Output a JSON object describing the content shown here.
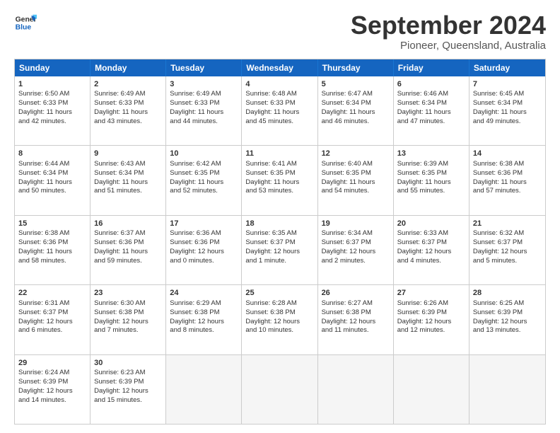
{
  "logo": {
    "line1": "General",
    "line2": "Blue"
  },
  "title": "September 2024",
  "subtitle": "Pioneer, Queensland, Australia",
  "header_days": [
    "Sunday",
    "Monday",
    "Tuesday",
    "Wednesday",
    "Thursday",
    "Friday",
    "Saturday"
  ],
  "weeks": [
    [
      {
        "day": "1",
        "lines": [
          "Sunrise: 6:50 AM",
          "Sunset: 6:33 PM",
          "Daylight: 11 hours",
          "and 42 minutes."
        ]
      },
      {
        "day": "2",
        "lines": [
          "Sunrise: 6:49 AM",
          "Sunset: 6:33 PM",
          "Daylight: 11 hours",
          "and 43 minutes."
        ]
      },
      {
        "day": "3",
        "lines": [
          "Sunrise: 6:49 AM",
          "Sunset: 6:33 PM",
          "Daylight: 11 hours",
          "and 44 minutes."
        ]
      },
      {
        "day": "4",
        "lines": [
          "Sunrise: 6:48 AM",
          "Sunset: 6:33 PM",
          "Daylight: 11 hours",
          "and 45 minutes."
        ]
      },
      {
        "day": "5",
        "lines": [
          "Sunrise: 6:47 AM",
          "Sunset: 6:34 PM",
          "Daylight: 11 hours",
          "and 46 minutes."
        ]
      },
      {
        "day": "6",
        "lines": [
          "Sunrise: 6:46 AM",
          "Sunset: 6:34 PM",
          "Daylight: 11 hours",
          "and 47 minutes."
        ]
      },
      {
        "day": "7",
        "lines": [
          "Sunrise: 6:45 AM",
          "Sunset: 6:34 PM",
          "Daylight: 11 hours",
          "and 49 minutes."
        ]
      }
    ],
    [
      {
        "day": "8",
        "lines": [
          "Sunrise: 6:44 AM",
          "Sunset: 6:34 PM",
          "Daylight: 11 hours",
          "and 50 minutes."
        ]
      },
      {
        "day": "9",
        "lines": [
          "Sunrise: 6:43 AM",
          "Sunset: 6:34 PM",
          "Daylight: 11 hours",
          "and 51 minutes."
        ]
      },
      {
        "day": "10",
        "lines": [
          "Sunrise: 6:42 AM",
          "Sunset: 6:35 PM",
          "Daylight: 11 hours",
          "and 52 minutes."
        ]
      },
      {
        "day": "11",
        "lines": [
          "Sunrise: 6:41 AM",
          "Sunset: 6:35 PM",
          "Daylight: 11 hours",
          "and 53 minutes."
        ]
      },
      {
        "day": "12",
        "lines": [
          "Sunrise: 6:40 AM",
          "Sunset: 6:35 PM",
          "Daylight: 11 hours",
          "and 54 minutes."
        ]
      },
      {
        "day": "13",
        "lines": [
          "Sunrise: 6:39 AM",
          "Sunset: 6:35 PM",
          "Daylight: 11 hours",
          "and 55 minutes."
        ]
      },
      {
        "day": "14",
        "lines": [
          "Sunrise: 6:38 AM",
          "Sunset: 6:36 PM",
          "Daylight: 11 hours",
          "and 57 minutes."
        ]
      }
    ],
    [
      {
        "day": "15",
        "lines": [
          "Sunrise: 6:38 AM",
          "Sunset: 6:36 PM",
          "Daylight: 11 hours",
          "and 58 minutes."
        ]
      },
      {
        "day": "16",
        "lines": [
          "Sunrise: 6:37 AM",
          "Sunset: 6:36 PM",
          "Daylight: 11 hours",
          "and 59 minutes."
        ]
      },
      {
        "day": "17",
        "lines": [
          "Sunrise: 6:36 AM",
          "Sunset: 6:36 PM",
          "Daylight: 12 hours",
          "and 0 minutes."
        ]
      },
      {
        "day": "18",
        "lines": [
          "Sunrise: 6:35 AM",
          "Sunset: 6:37 PM",
          "Daylight: 12 hours",
          "and 1 minute."
        ]
      },
      {
        "day": "19",
        "lines": [
          "Sunrise: 6:34 AM",
          "Sunset: 6:37 PM",
          "Daylight: 12 hours",
          "and 2 minutes."
        ]
      },
      {
        "day": "20",
        "lines": [
          "Sunrise: 6:33 AM",
          "Sunset: 6:37 PM",
          "Daylight: 12 hours",
          "and 4 minutes."
        ]
      },
      {
        "day": "21",
        "lines": [
          "Sunrise: 6:32 AM",
          "Sunset: 6:37 PM",
          "Daylight: 12 hours",
          "and 5 minutes."
        ]
      }
    ],
    [
      {
        "day": "22",
        "lines": [
          "Sunrise: 6:31 AM",
          "Sunset: 6:37 PM",
          "Daylight: 12 hours",
          "and 6 minutes."
        ]
      },
      {
        "day": "23",
        "lines": [
          "Sunrise: 6:30 AM",
          "Sunset: 6:38 PM",
          "Daylight: 12 hours",
          "and 7 minutes."
        ]
      },
      {
        "day": "24",
        "lines": [
          "Sunrise: 6:29 AM",
          "Sunset: 6:38 PM",
          "Daylight: 12 hours",
          "and 8 minutes."
        ]
      },
      {
        "day": "25",
        "lines": [
          "Sunrise: 6:28 AM",
          "Sunset: 6:38 PM",
          "Daylight: 12 hours",
          "and 10 minutes."
        ]
      },
      {
        "day": "26",
        "lines": [
          "Sunrise: 6:27 AM",
          "Sunset: 6:38 PM",
          "Daylight: 12 hours",
          "and 11 minutes."
        ]
      },
      {
        "day": "27",
        "lines": [
          "Sunrise: 6:26 AM",
          "Sunset: 6:39 PM",
          "Daylight: 12 hours",
          "and 12 minutes."
        ]
      },
      {
        "day": "28",
        "lines": [
          "Sunrise: 6:25 AM",
          "Sunset: 6:39 PM",
          "Daylight: 12 hours",
          "and 13 minutes."
        ]
      }
    ],
    [
      {
        "day": "29",
        "lines": [
          "Sunrise: 6:24 AM",
          "Sunset: 6:39 PM",
          "Daylight: 12 hours",
          "and 14 minutes."
        ]
      },
      {
        "day": "30",
        "lines": [
          "Sunrise: 6:23 AM",
          "Sunset: 6:39 PM",
          "Daylight: 12 hours",
          "and 15 minutes."
        ]
      },
      {
        "day": "",
        "lines": []
      },
      {
        "day": "",
        "lines": []
      },
      {
        "day": "",
        "lines": []
      },
      {
        "day": "",
        "lines": []
      },
      {
        "day": "",
        "lines": []
      }
    ]
  ]
}
